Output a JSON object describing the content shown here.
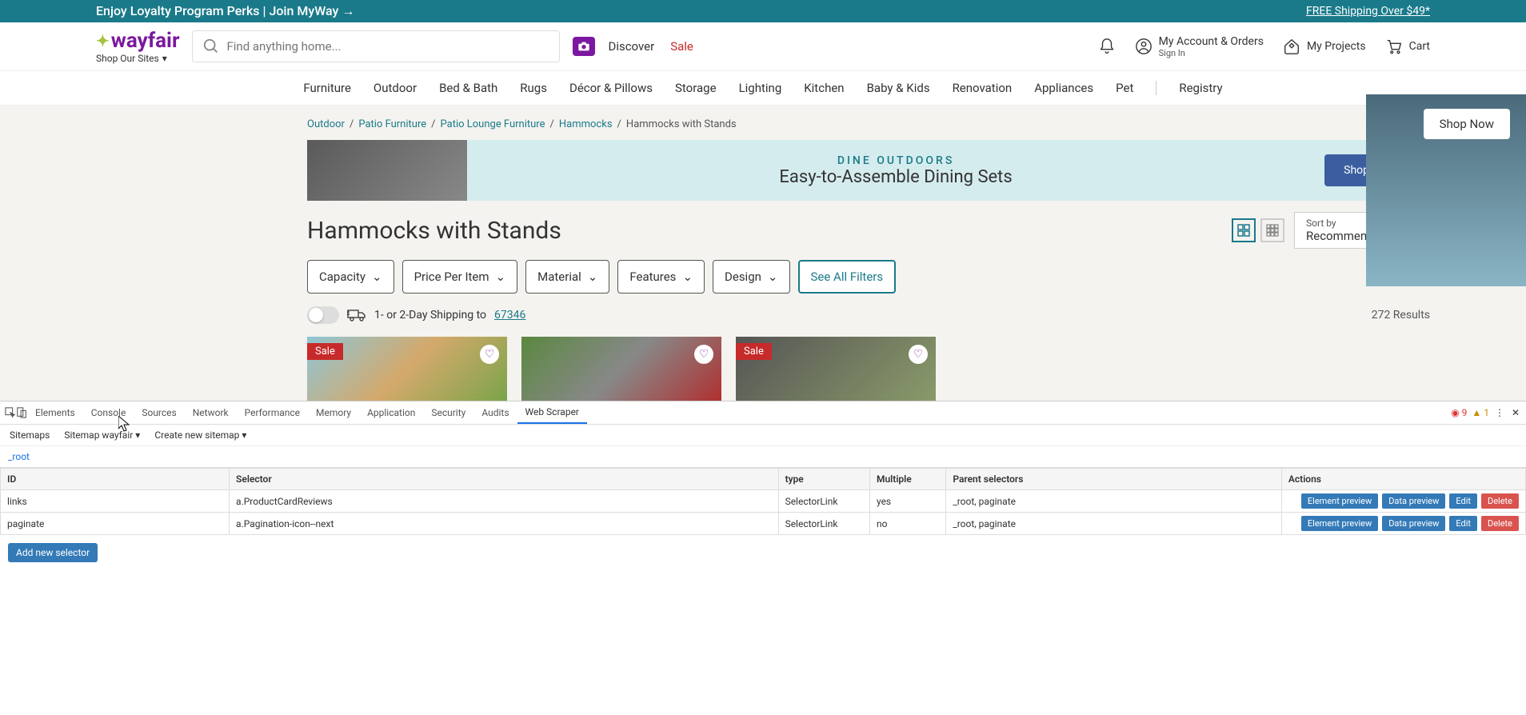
{
  "promo": {
    "left": "Enjoy Loyalty Program Perks | Join MyWay →",
    "right": "FREE Shipping Over $49*"
  },
  "header": {
    "logo": "wayfair",
    "shop_sites": "Shop Our Sites",
    "search_placeholder": "Find anything home...",
    "discover": "Discover",
    "sale": "Sale",
    "account_title": "My Account & Orders",
    "account_sub": "Sign In",
    "projects": "My Projects",
    "cart": "Cart"
  },
  "nav": [
    "Furniture",
    "Outdoor",
    "Bed & Bath",
    "Rugs",
    "Décor & Pillows",
    "Storage",
    "Lighting",
    "Kitchen",
    "Baby & Kids",
    "Renovation",
    "Appliances",
    "Pet"
  ],
  "nav_registry": "Registry",
  "breadcrumb": [
    "Outdoor",
    "Patio Furniture",
    "Patio Lounge Furniture",
    "Hammocks"
  ],
  "breadcrumb_current": "Hammocks with Stands",
  "banner": {
    "eyebrow": "DINE OUTDOORS",
    "headline": "Easy-to-Assemble Dining Sets",
    "cta": "Shop Now"
  },
  "page_title": "Hammocks with Stands",
  "sort": {
    "label": "Sort by",
    "value": "Recommended"
  },
  "filters": [
    "Capacity",
    "Price Per Item",
    "Material",
    "Features",
    "Design"
  ],
  "see_all": "See All Filters",
  "shipping": {
    "label": "1- or 2-Day Shipping to",
    "zip": "67346"
  },
  "results_count": "272 Results",
  "products": [
    {
      "sale": "Sale"
    },
    {
      "sale": ""
    },
    {
      "sale": "Sale"
    }
  ],
  "side_cta": "Shop Now",
  "devtools": {
    "tabs": [
      "Elements",
      "Console",
      "Sources",
      "Network",
      "Performance",
      "Memory",
      "Application",
      "Security",
      "Audits",
      "Web Scraper"
    ],
    "active_tab": "Web Scraper",
    "err_count": "9",
    "warn_count": "1",
    "ws_bar": {
      "sitemaps": "Sitemaps",
      "current": "Sitemap wayfair",
      "create": "Create new sitemap"
    },
    "breadpath": "_root",
    "headers": {
      "id": "ID",
      "selector": "Selector",
      "type": "type",
      "multiple": "Multiple",
      "parent": "Parent selectors",
      "actions": "Actions"
    },
    "rows": [
      {
        "id": "links",
        "selector": "a.ProductCardReviews",
        "type": "SelectorLink",
        "multiple": "yes",
        "parent": "_root, paginate"
      },
      {
        "id": "paginate",
        "selector": "a.Pagination-icon--next",
        "type": "SelectorLink",
        "multiple": "no",
        "parent": "_root, paginate"
      }
    ],
    "actions": {
      "ep": "Element preview",
      "dp": "Data preview",
      "edit": "Edit",
      "del": "Delete"
    },
    "add_new": "Add new selector"
  }
}
